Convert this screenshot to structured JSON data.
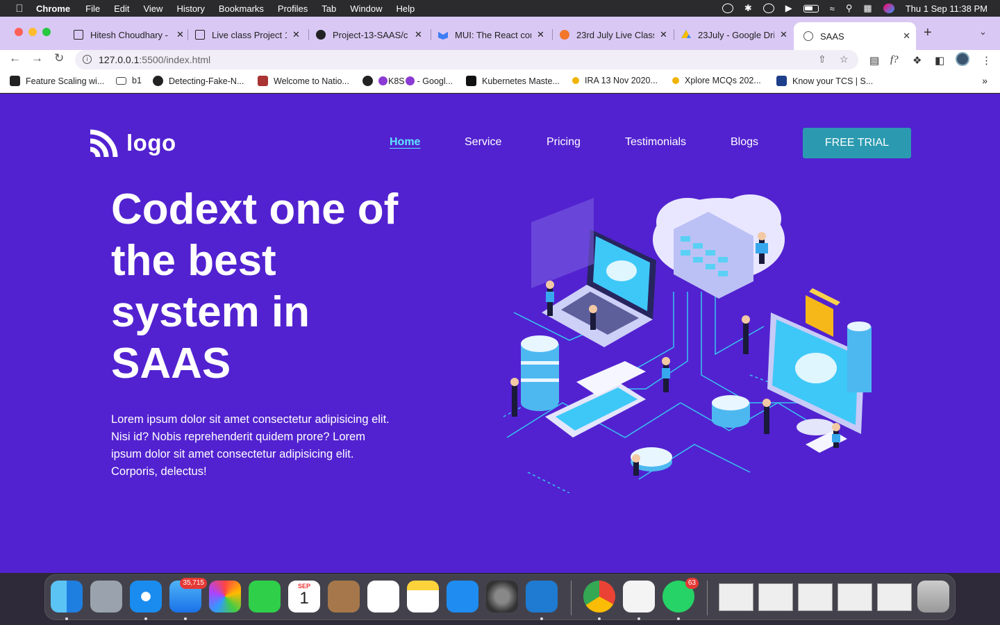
{
  "menubar": {
    "app": "Chrome",
    "items": [
      "File",
      "Edit",
      "View",
      "History",
      "Bookmarks",
      "Profiles",
      "Tab",
      "Window",
      "Help"
    ],
    "datetime": "Thu 1 Sep  11:38 PM"
  },
  "tabs": [
    {
      "title": "Hitesh Choudhary -",
      "icon": "notion-icon"
    },
    {
      "title": "Live class Project 1",
      "icon": "notion-icon"
    },
    {
      "title": "Project-13-SAAS/c",
      "icon": "github-icon"
    },
    {
      "title": "MUI: The React com",
      "icon": "mui-icon"
    },
    {
      "title": "23rd July Live Class",
      "icon": "video-icon"
    },
    {
      "title": "23July - Google Dri",
      "icon": "google-drive-icon"
    },
    {
      "title": "SAAS",
      "icon": "globe-icon",
      "active": true
    }
  ],
  "address": {
    "host": "127.0.0.1",
    "rest": ":5500/index.html"
  },
  "bookmarks": [
    "Feature Scaling wi...",
    "b1",
    "Detecting-Fake-N...",
    "Welcome to Natio...",
    "K8S",
    "- Googl...",
    "Kubernetes Maste...",
    "IRA 13 Nov 2020...",
    "Xplore MCQs 202...",
    "Know your TCS | S..."
  ],
  "site": {
    "logo": "logo",
    "nav": [
      "Home",
      "Service",
      "Pricing",
      "Testimonials",
      "Blogs"
    ],
    "cta": "FREE TRIAL",
    "hero_title": "Codext one of the best system in SAAS",
    "hero_desc": "Lorem ipsum dolor sit amet consectetur adipisicing elit. Nisi id? Nobis reprehenderit quidem prore? Lorem ipsum dolor sit amet consectetur adipisicing elit. Corporis, delectus!",
    "colors": {
      "background": "#5222d0",
      "accent": "#5fe6ff",
      "cta": "#2b9ab0"
    }
  },
  "dock": {
    "mail_badge": "35,715",
    "whatsapp_badge": "63",
    "calendar_month": "SEP",
    "calendar_day": "1"
  }
}
